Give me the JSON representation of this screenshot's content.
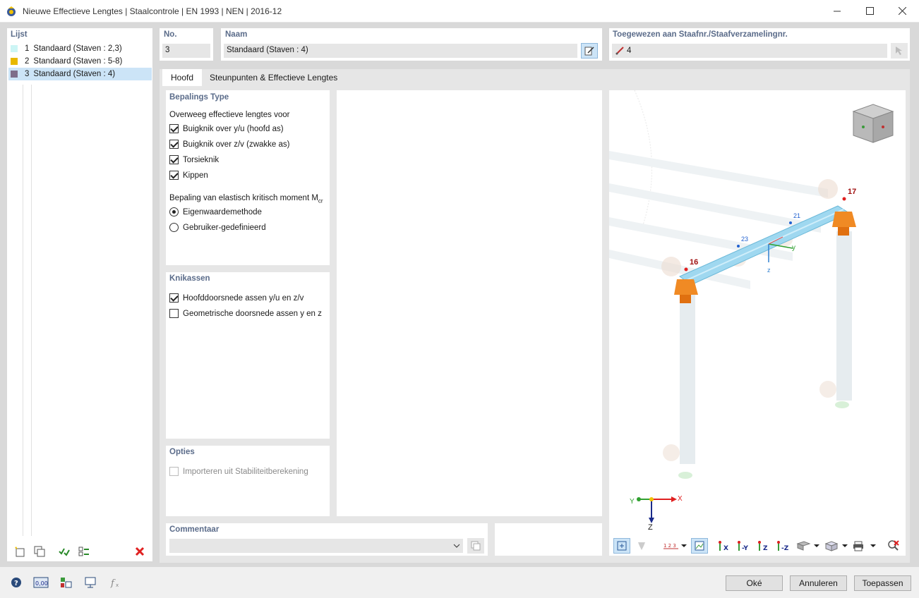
{
  "window": {
    "title": "Nieuwe Effectieve Lengtes | Staalcontrole | EN 1993 | NEN | 2016-12"
  },
  "list": {
    "header": "Lijst",
    "items": [
      {
        "num": "1",
        "label": "Standaard (Staven : 2,3)",
        "color": "#ccf5f5"
      },
      {
        "num": "2",
        "label": "Standaard (Staven : 5-8)",
        "color": "#e8b800"
      },
      {
        "num": "3",
        "label": "Standaard (Staven : 4)",
        "color": "#7e6d8a"
      }
    ]
  },
  "no": {
    "header": "No.",
    "value": "3"
  },
  "naam": {
    "header": "Naam",
    "value": "Standaard (Staven : 4)"
  },
  "assigned": {
    "header": "Toegewezen aan Staafnr./Staafverzamelingnr.",
    "value": "4"
  },
  "tabs": [
    "Hoofd",
    "Steunpunten & Effectieve Lengtes"
  ],
  "bepaling": {
    "header": "Bepalings Type",
    "subheader": "Overweeg effectieve lengtes voor",
    "checks": [
      {
        "label": "Buigknik over y/u (hoofd as)",
        "checked": true
      },
      {
        "label": "Buigknik over z/v (zwakke as)",
        "checked": true
      },
      {
        "label": "Torsieknik",
        "checked": true
      },
      {
        "label": "Kippen",
        "checked": true
      }
    ],
    "mcr_label": "Bepaling van elastisch kritisch moment M",
    "mcr_sub": "cr",
    "radios": [
      {
        "label": "Eigenwaardemethode",
        "selected": true
      },
      {
        "label": "Gebruiker-gedefinieerd",
        "selected": false
      }
    ]
  },
  "knikassen": {
    "header": "Knikassen",
    "checks": [
      {
        "label": "Hoofddoorsnede assen y/u en z/v",
        "checked": true
      },
      {
        "label": "Geometrische doorsnede assen y en z",
        "checked": false
      }
    ]
  },
  "opties": {
    "header": "Opties",
    "checks": [
      {
        "label": "Importeren uit Stabiliteitberekening",
        "checked": false
      }
    ]
  },
  "commentaar": {
    "header": "Commentaar",
    "value": ""
  },
  "view3d": {
    "node_labels": [
      "16",
      "17",
      "23",
      "21"
    ],
    "axis_labels": {
      "x": "X",
      "y": "Y",
      "z": "Z",
      "local_y": "y",
      "local_z": "z"
    }
  },
  "buttons": {
    "ok": "Oké",
    "cancel": "Annuleren",
    "apply": "Toepassen"
  },
  "colors": {
    "accent": "#5b6c8a",
    "selection": "#cce4f7",
    "support": "#f08a24",
    "beam": "#9fd8f0",
    "delete": "#e02020"
  }
}
